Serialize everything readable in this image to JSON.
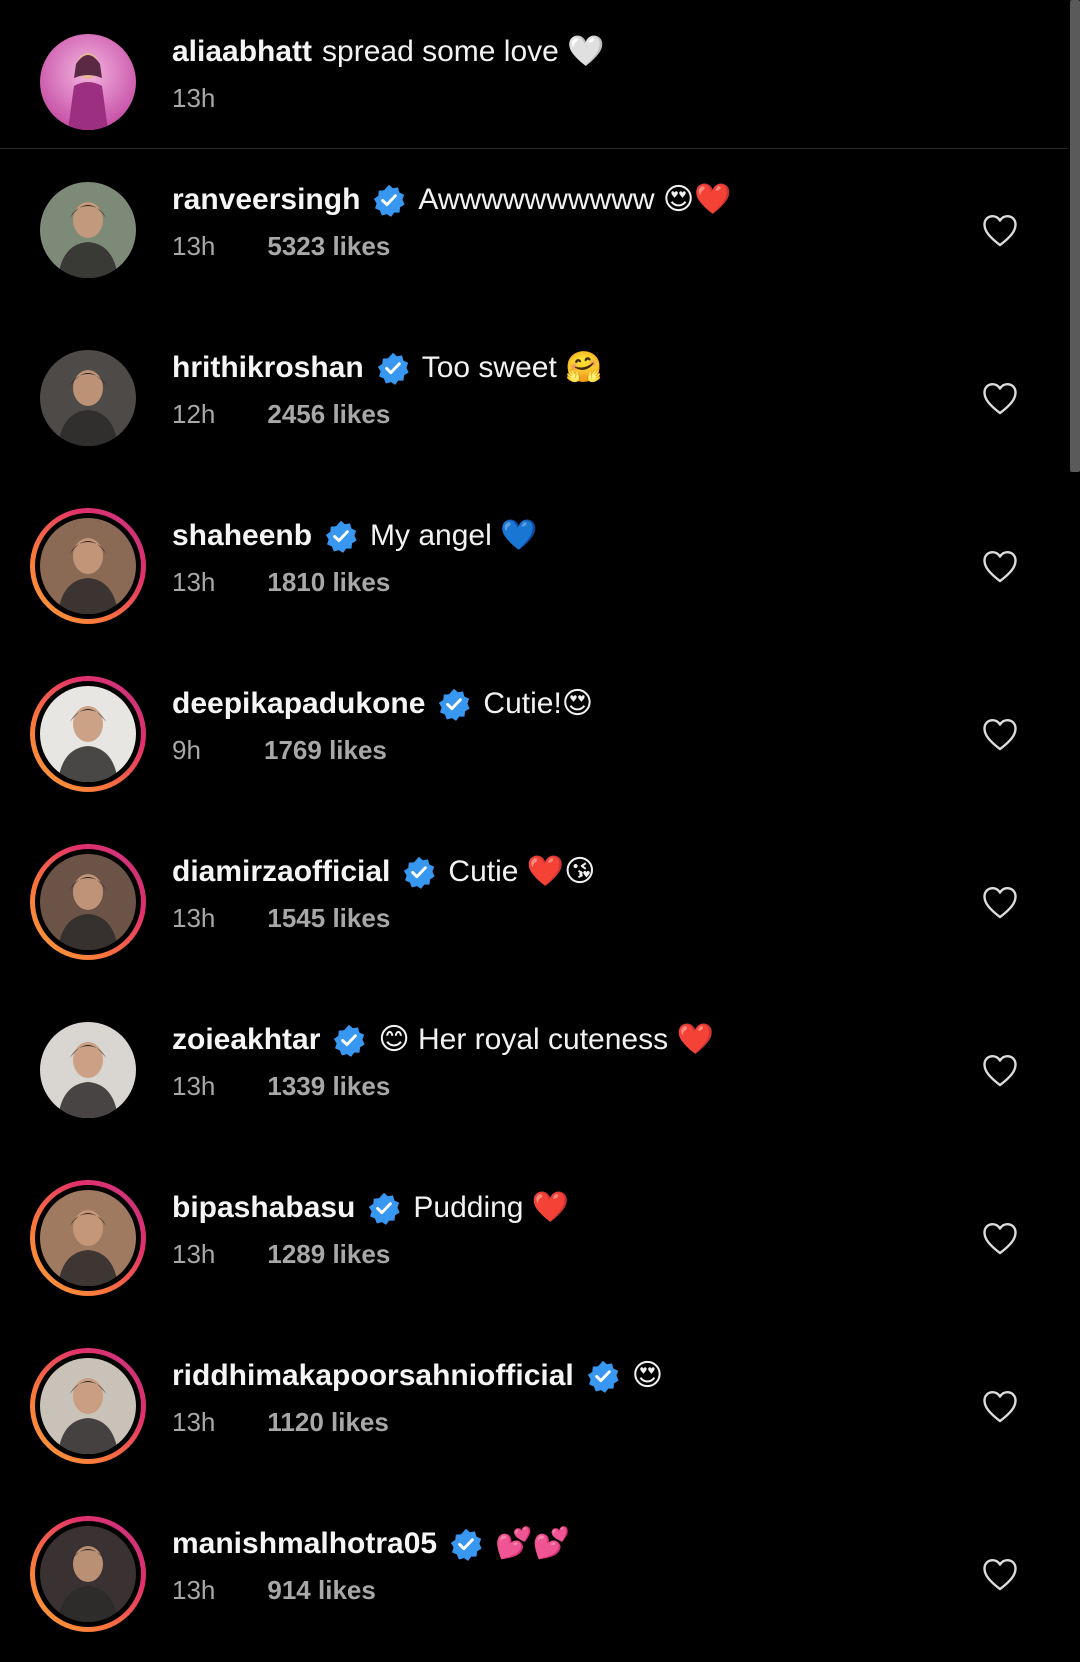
{
  "caption": {
    "username": "aliaabhatt",
    "text": "spread some love 🤍",
    "time": "13h"
  },
  "comments": [
    {
      "username": "ranveersingh",
      "text": "Awwwwwwwwww 😍❤️",
      "time": "13h",
      "likes": "5323 likes",
      "story_ring": false,
      "avatar_color": "#7d8a78"
    },
    {
      "username": "hrithikroshan",
      "text": "Too sweet 🤗",
      "time": "12h",
      "likes": "2456 likes",
      "story_ring": false,
      "avatar_color": "#4e4a48"
    },
    {
      "username": "shaheenb",
      "text": "My angel 💙",
      "time": "13h",
      "likes": "1810 likes",
      "story_ring": true,
      "avatar_color": "#8a6a55"
    },
    {
      "username": "deepikapadukone",
      "text": "Cutie!😍",
      "time": "9h",
      "likes": "1769 likes",
      "story_ring": true,
      "avatar_color": "#e8e6e2"
    },
    {
      "username": "diamirzaofficial",
      "text": "Cutie ❤️😘",
      "time": "13h",
      "likes": "1545 likes",
      "story_ring": true,
      "avatar_color": "#6b5347"
    },
    {
      "username": "zoieakhtar",
      "text": "😊 Her royal cuteness ❤️",
      "time": "13h",
      "likes": "1339 likes",
      "story_ring": false,
      "avatar_color": "#d9d6d2"
    },
    {
      "username": "bipashabasu",
      "text": "Pudding ❤️",
      "time": "13h",
      "likes": "1289 likes",
      "story_ring": true,
      "avatar_color": "#a07a60"
    },
    {
      "username": "riddhimakapoorsahniofficial",
      "text": "😍",
      "time": "13h",
      "likes": "1120 likes",
      "story_ring": true,
      "avatar_color": "#c9c2b8"
    },
    {
      "username": "manishmalhotra05",
      "text": "💕💕",
      "time": "13h",
      "likes": "914 likes",
      "story_ring": true,
      "avatar_color": "#3a3232"
    }
  ],
  "colors": {
    "background": "#000000",
    "verified_badge": "#3897f0",
    "secondary_text": "#a8a8a8"
  },
  "icons": {
    "verified": "verified-badge-icon",
    "like": "heart-outline-icon"
  }
}
